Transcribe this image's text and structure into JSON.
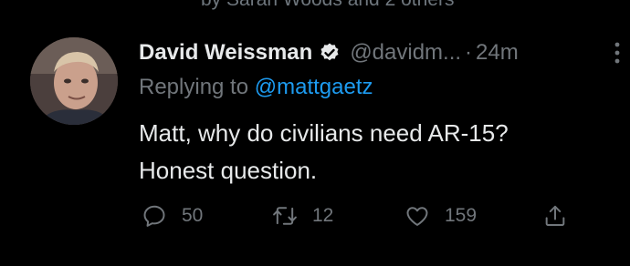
{
  "context": {
    "clipped_text": "by Sarah Woods and 2 others"
  },
  "tweet": {
    "author_name": "David Weissman",
    "handle": "@davidm...",
    "separator": "·",
    "time": "24m",
    "replying_prefix": "Replying to ",
    "replying_to": "@mattgaetz",
    "text_line1": "Matt, why do civilians need AR-15?",
    "text_line2": "Honest question.",
    "verified": true
  },
  "actions": {
    "reply_count": "50",
    "retweet_count": "12",
    "like_count": "159"
  },
  "icons": [
    "verified-badge-icon",
    "more-icon",
    "reply-icon",
    "retweet-icon",
    "like-icon",
    "share-icon"
  ],
  "colors": {
    "background": "#000000",
    "text": "#e7e9ea",
    "muted": "#71767b",
    "link": "#1d9bf0"
  }
}
